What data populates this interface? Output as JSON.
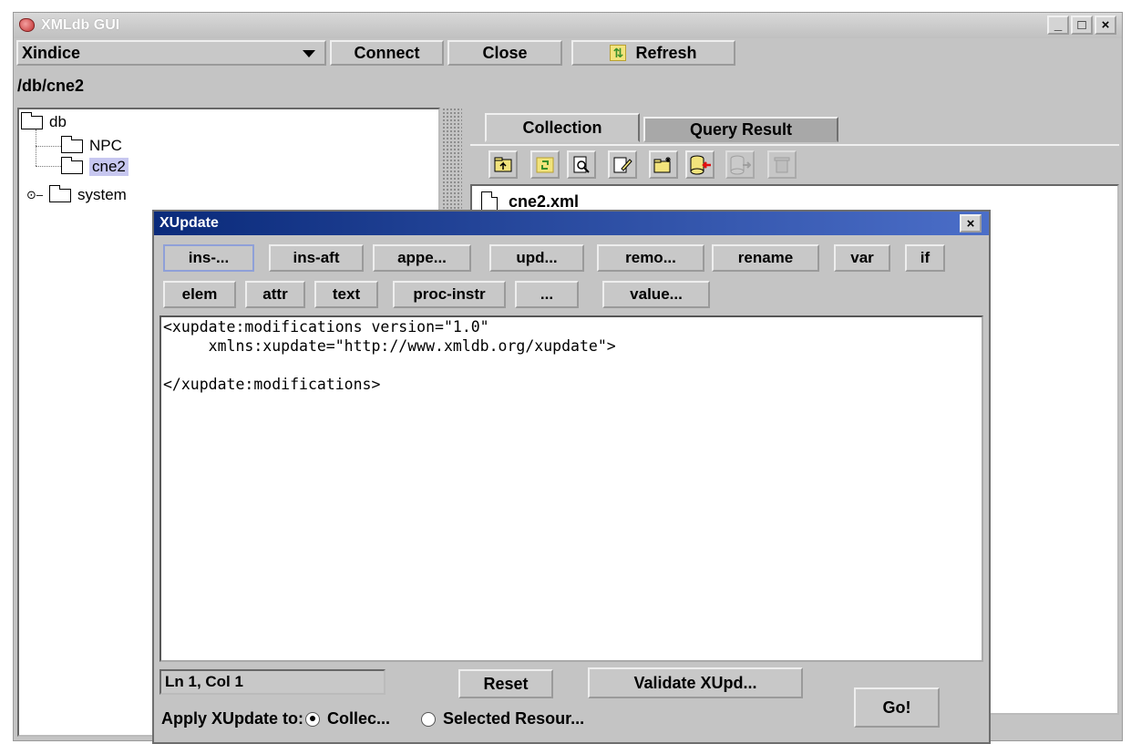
{
  "window": {
    "title": "XMLdb GUI",
    "minimize": "_",
    "maximize": "□",
    "close": "×"
  },
  "toolbar": {
    "driver": "Xindice",
    "connect": "Connect",
    "close": "Close",
    "refresh": "Refresh"
  },
  "path": "/db/cne2",
  "tree": {
    "root": "db",
    "children": [
      "NPC",
      "cne2",
      "system"
    ],
    "selected": "cne2"
  },
  "tabs": [
    "Collection",
    "Query Result"
  ],
  "resources": [
    "cne2.xml"
  ],
  "icons": {
    "app": "xmldb-app-icon",
    "toolbar": [
      "parent-collection-icon",
      "refresh-icon",
      "find-icon",
      "edit-icon",
      "new-collection-icon",
      "import-icon",
      "export-icon",
      "delete-icon"
    ]
  },
  "xupdate": {
    "title": "XUpdate",
    "close": "×",
    "row1": [
      "ins-...",
      "ins-aft",
      "appe...",
      "upd...",
      "remo...",
      "rename",
      "var",
      "if"
    ],
    "row2": [
      "elem",
      "attr",
      "text",
      "proc-instr",
      "...",
      "value..."
    ],
    "editor_lines": [
      "<xupdate:modifications version=\"1.0\"",
      "     xmlns:xupdate=\"http://www.xmldb.org/xupdate\">",
      "",
      "</xupdate:modifications>"
    ],
    "status": "Ln 1, Col 1",
    "reset": "Reset",
    "validate": "Validate XUpd...",
    "go": "Go!",
    "apply_label": "Apply XUpdate to:",
    "option_collection": "Collec...",
    "option_selected": "Selected Resour...",
    "apply_target": "Collection"
  }
}
